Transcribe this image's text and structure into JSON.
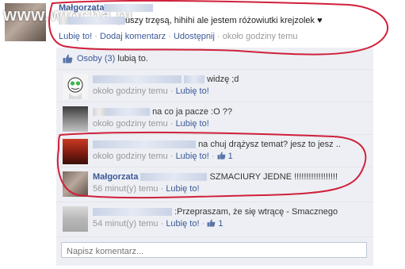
{
  "watermark": "www.wiocha.pl",
  "post": {
    "author": "Małgorzata",
    "text_before": "",
    "text_after": "uszy trzęsą, hihihi ale jestem różowiutki krejzolek ♥",
    "like": "Lubię to!",
    "comment": "Dodaj komentarz",
    "share": "Udostępnij",
    "time": "około godziny temu"
  },
  "likes": {
    "people": "Osoby",
    "count": "(3)",
    "suffix": "lubią to."
  },
  "comments": [
    {
      "text": "widzę ;d",
      "time": "około godziny temu",
      "like": "Lubię to!",
      "likes": ""
    },
    {
      "text": "na co ja pacze :O ??",
      "time": "około godziny temu",
      "like": "Lubię to!",
      "likes": ""
    },
    {
      "text": "na chuj drążysz temat? jesz to jesz ..",
      "time": "około godziny temu",
      "like": "Lubię to!",
      "likes": "1"
    },
    {
      "name": "Małgorzata",
      "text": "SZMACIURY JEDNE !!!!!!!!!!!!!!!!!!",
      "time": "56 minut(y) temu",
      "like": "Lubię to!",
      "likes": ""
    },
    {
      "text": ":Przepraszam, że się wtrącę - Smacznego",
      "time": "54 minut(y) temu",
      "like": "Lubię to!",
      "likes": "1"
    }
  ],
  "write_placeholder": "Napisz komentarz...",
  "colors": {
    "link": "#3b5998",
    "annotation": "#d0203a",
    "feed_bg": "#edeff4"
  }
}
